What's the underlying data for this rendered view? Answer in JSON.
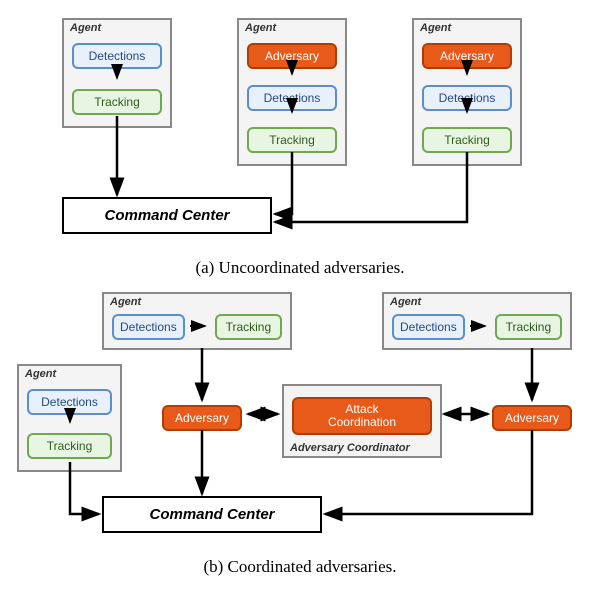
{
  "labels": {
    "agent": "Agent",
    "detections": "Detections",
    "tracking": "Tracking",
    "adversary": "Adversary",
    "attack_coordination": "Attack\nCoordination",
    "adversary_coordinator": "Adversary Coordinator",
    "command_center": "Command Center"
  },
  "captions": {
    "a": "(a) Uncoordinated adversaries.",
    "b": "(b) Coordinated adversaries."
  },
  "colors": {
    "detections_bg": "#e8f1fb",
    "detections_border": "#5a8fcf",
    "tracking_bg": "#e9f5e3",
    "tracking_border": "#6fa850",
    "adversary_bg": "#e85a1a",
    "adversary_border": "#b43c00",
    "agent_bg": "#f4f4f4",
    "agent_border": "#888888"
  },
  "chart_data": [
    {
      "id": "a",
      "type": "diagram",
      "title": "Uncoordinated adversaries",
      "nodes": [
        {
          "id": "ag1",
          "type": "agent",
          "children": [
            "d1",
            "t1"
          ]
        },
        {
          "id": "d1",
          "type": "detections"
        },
        {
          "id": "t1",
          "type": "tracking"
        },
        {
          "id": "ag2",
          "type": "agent",
          "children": [
            "adv2",
            "d2",
            "t2"
          ]
        },
        {
          "id": "adv2",
          "type": "adversary"
        },
        {
          "id": "d2",
          "type": "detections"
        },
        {
          "id": "t2",
          "type": "tracking"
        },
        {
          "id": "ag3",
          "type": "agent",
          "children": [
            "adv3",
            "d3",
            "t3"
          ]
        },
        {
          "id": "adv3",
          "type": "adversary"
        },
        {
          "id": "d3",
          "type": "detections"
        },
        {
          "id": "t3",
          "type": "tracking"
        },
        {
          "id": "cc",
          "type": "command_center"
        }
      ],
      "edges": [
        {
          "from": "d1",
          "to": "t1"
        },
        {
          "from": "adv2",
          "to": "d2"
        },
        {
          "from": "d2",
          "to": "t2"
        },
        {
          "from": "adv3",
          "to": "d3"
        },
        {
          "from": "d3",
          "to": "t3"
        },
        {
          "from": "t1",
          "to": "cc"
        },
        {
          "from": "t2",
          "to": "cc"
        },
        {
          "from": "t3",
          "to": "cc"
        }
      ]
    },
    {
      "id": "b",
      "type": "diagram",
      "title": "Coordinated adversaries",
      "nodes": [
        {
          "id": "ag1",
          "type": "agent",
          "children": [
            "d1",
            "t1"
          ]
        },
        {
          "id": "d1",
          "type": "detections"
        },
        {
          "id": "t1",
          "type": "tracking"
        },
        {
          "id": "ag2",
          "type": "agent",
          "children": [
            "d2",
            "t2"
          ]
        },
        {
          "id": "d2",
          "type": "detections"
        },
        {
          "id": "t2",
          "type": "tracking"
        },
        {
          "id": "ag3",
          "type": "agent",
          "children": [
            "d3",
            "t3"
          ]
        },
        {
          "id": "d3",
          "type": "detections"
        },
        {
          "id": "t3",
          "type": "tracking"
        },
        {
          "id": "advL",
          "type": "adversary"
        },
        {
          "id": "advR",
          "type": "adversary"
        },
        {
          "id": "coord",
          "type": "attack_coordination",
          "container": "adversary_coordinator"
        },
        {
          "id": "cc",
          "type": "command_center"
        }
      ],
      "edges": [
        {
          "from": "d1",
          "to": "t1"
        },
        {
          "from": "d2",
          "to": "t2"
        },
        {
          "from": "d3",
          "to": "t3"
        },
        {
          "from": "t2",
          "to": "advL"
        },
        {
          "from": "t3",
          "to": "advR"
        },
        {
          "from": "advL",
          "to": "coord",
          "bidir": true
        },
        {
          "from": "coord",
          "to": "advR",
          "bidir": true
        },
        {
          "from": "t1",
          "to": "cc"
        },
        {
          "from": "advL",
          "to": "cc"
        },
        {
          "from": "advR",
          "to": "cc"
        }
      ]
    }
  ]
}
